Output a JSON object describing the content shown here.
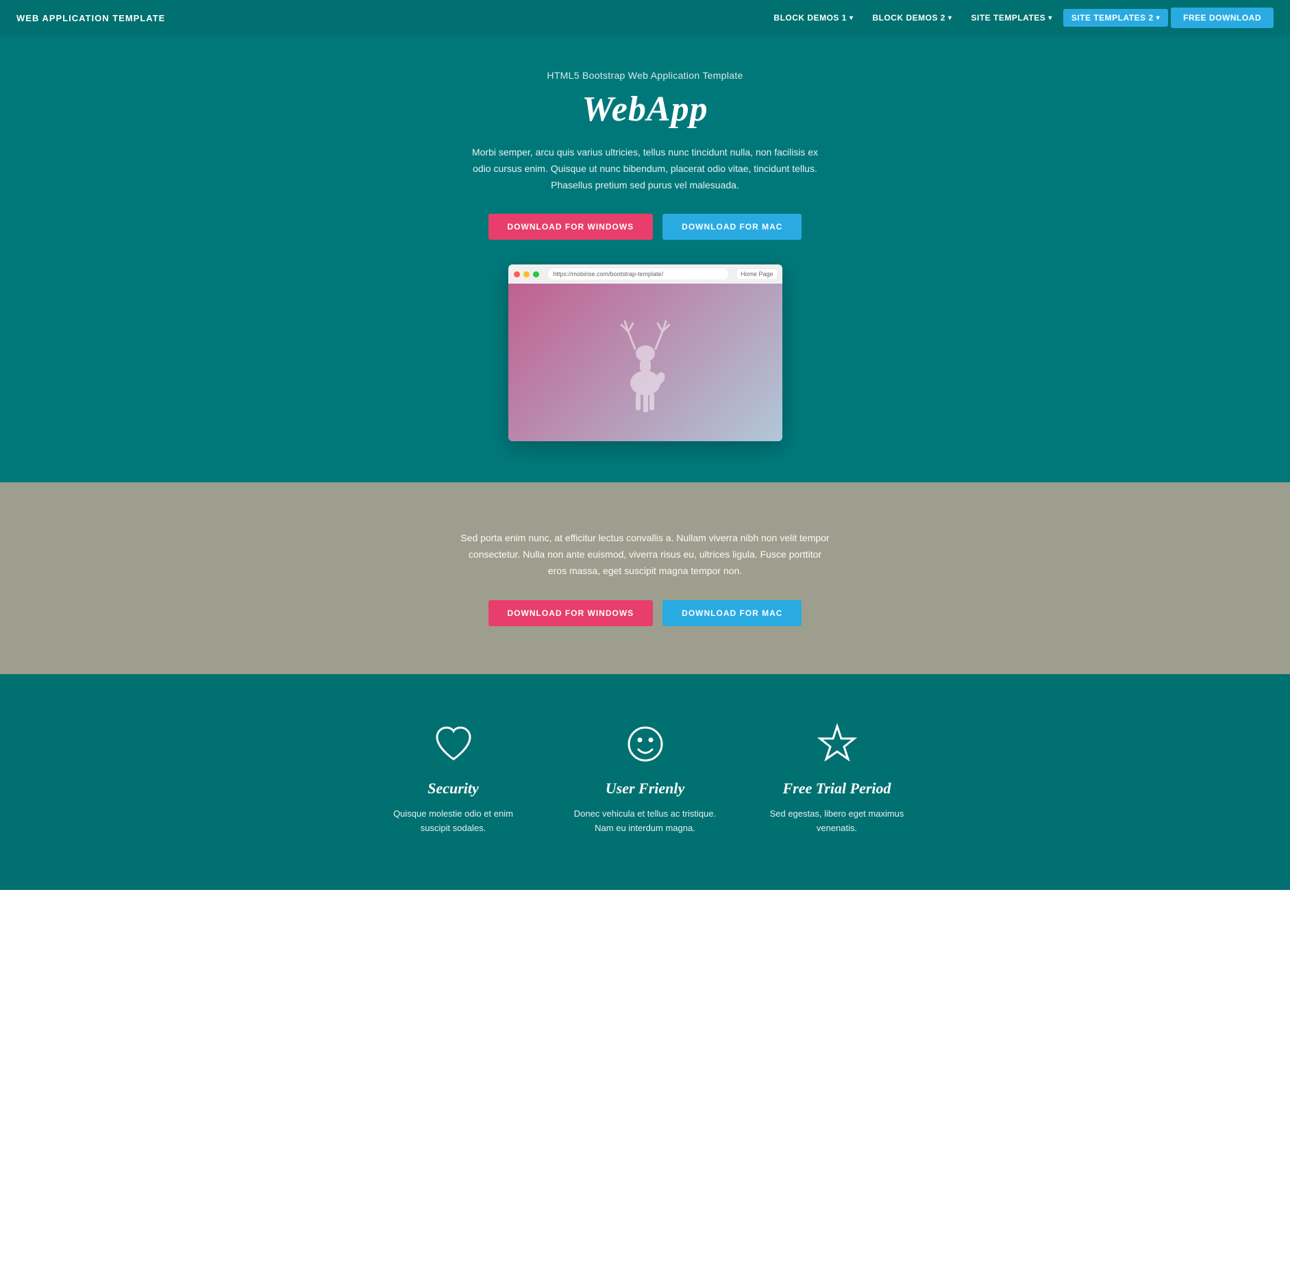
{
  "navbar": {
    "brand": "WEB APPLICATION TEMPLATE",
    "links": [
      {
        "label": "BLOCK DEMOS 1",
        "hasDropdown": true,
        "active": false
      },
      {
        "label": "BLOCK DEMOS 2",
        "hasDropdown": true,
        "active": false
      },
      {
        "label": "SITE TEMPLATES",
        "hasDropdown": true,
        "active": false
      },
      {
        "label": "SITE TEMPLATES 2",
        "hasDropdown": true,
        "active": true
      }
    ],
    "cta": "FREE DOWNLOAD"
  },
  "hero": {
    "subtitle": "HTML5 Bootstrap Web Application Template",
    "title": "WebApp",
    "description": "Morbi semper, arcu quis varius ultricies, tellus nunc tincidunt nulla, non facilisis ex odio cursus enim. Quisque ut nunc bibendum, placerat odio vitae, tincidunt tellus. Phasellus pretium sed purus vel malesuada.",
    "btn_windows": "DOWNLOAD FOR WINDOWS",
    "btn_mac": "DOWNLOAD FOR MAC",
    "browser_url": "https://mobirise.com/bootstrap-template/",
    "browser_home": "Home Page"
  },
  "gray_section": {
    "description": "Sed porta enim nunc, at efficitur lectus convallis a. Nullam viverra nibh non velit tempor consectetur. Nulla non ante euismod, viverra risus eu, ultrices ligula. Fusce porttitor eros massa, eget suscipit magna tempor non.",
    "btn_windows": "DOWNLOAD FOR WINDOWS",
    "btn_mac": "DOWNLOAD FOR MAC"
  },
  "features": {
    "items": [
      {
        "icon": "heart",
        "title": "Security",
        "description": "Quisque molestie odio et enim suscipit sodales."
      },
      {
        "icon": "smiley",
        "title": "User Frienly",
        "description": "Donec vehicula et tellus ac tristique. Nam eu interdum magna."
      },
      {
        "icon": "star",
        "title": "Free Trial Period",
        "description": "Sed egestas, libero eget maximus venenatis."
      }
    ]
  },
  "colors": {
    "teal": "#007070",
    "pink": "#e83e6c",
    "blue": "#29abe2",
    "gray": "#9e9e8e"
  }
}
